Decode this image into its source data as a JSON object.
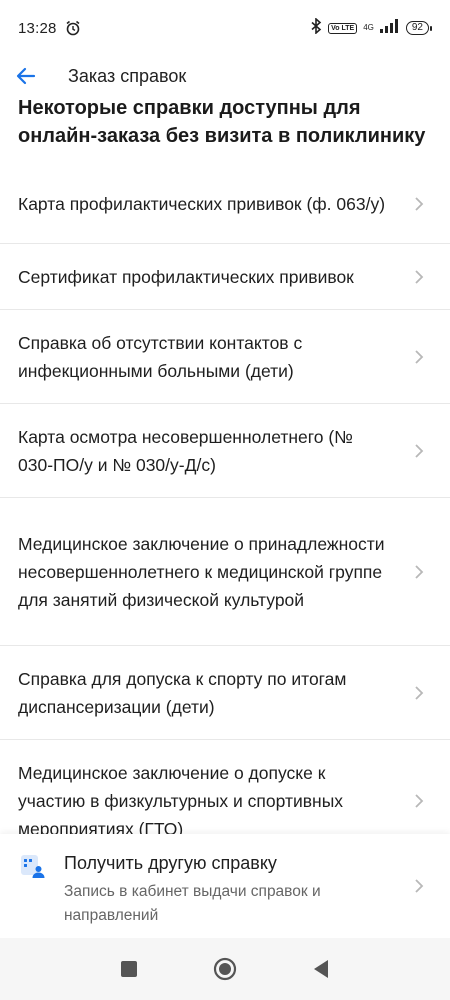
{
  "status": {
    "time": "13:28",
    "network_badge": "Vo LTE",
    "network_type": "4G",
    "battery": "92"
  },
  "header": {
    "title": "Заказ справок"
  },
  "section": {
    "heading": "Некоторые справки доступны для онлайн-заказа без визита в поликлинику"
  },
  "items": [
    {
      "label": "Карта профилактических прививок (ф. 063/у)"
    },
    {
      "label": "Сертификат профилактических прививок"
    },
    {
      "label": "Справка об отсутствии контактов с инфекционными больными (дети)"
    },
    {
      "label": "Карта осмотра несовершеннолетнего (№ 030-ПО/у и № 030/у-Д/с)"
    },
    {
      "label": "Медицинское заключение о принадлежности несовершеннолетнего к медицинской группе для занятий физической культурой"
    },
    {
      "label": "Справка для допуска к спорту по итогам диспансеризации (дети)"
    },
    {
      "label": "Медицинское заключение о допуске к участию в физкультурных и спортивных мероприятиях (ГТО)"
    }
  ],
  "bottom_card": {
    "title": "Получить другую справку",
    "subtitle": "Запись в кабинет выдачи справок и направлений"
  },
  "colors": {
    "accent": "#1a73e8",
    "divider": "#e8e8e8",
    "chevron": "#b8b8b8"
  }
}
